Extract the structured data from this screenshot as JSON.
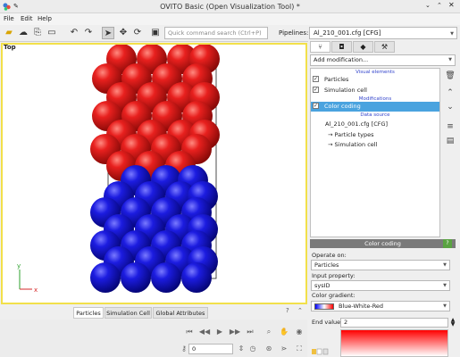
{
  "window": {
    "title": "OVITO Basic (Open Visualization Tool) *"
  },
  "menu": [
    "File",
    "Edit",
    "Help"
  ],
  "toolbar": {
    "search_placeholder": "Quick command search (Ctrl+P)",
    "pipelines_label": "Pipelines:",
    "pipeline_value": "Al_210_001.cfg [CFG]"
  },
  "viewport": {
    "label": "Top",
    "axis_x": "x",
    "axis_y": "y",
    "colors": {
      "top": "#e8201e",
      "bottom": "#1c1ce0",
      "frame": "#f2e04a"
    }
  },
  "bottom_tabs": [
    "Particles",
    "Simulation Cell",
    "Global Attributes"
  ],
  "animation": {
    "frame_value": "0"
  },
  "panel": {
    "add_modification": "Add modification...",
    "sections": {
      "visual": "Visual elements",
      "modifications": "Modifications",
      "data_source": "Data source"
    },
    "visual_items": [
      "Particles",
      "Simulation cell"
    ],
    "modifier": "Color coding",
    "source_file": "Al_210_001.cfg [CFG]",
    "source_items": [
      "→ Particle types",
      "→ Simulation cell"
    ]
  },
  "color_coding": {
    "header": "Color coding",
    "help": "?",
    "operate_on_label": "Operate on:",
    "operate_on": "Particles",
    "input_label": "Input property:",
    "input_property": "sysID",
    "gradient_label": "Color gradient:",
    "gradient": "Blue-White-Red",
    "end_label": "End value:",
    "end_value": "2"
  }
}
